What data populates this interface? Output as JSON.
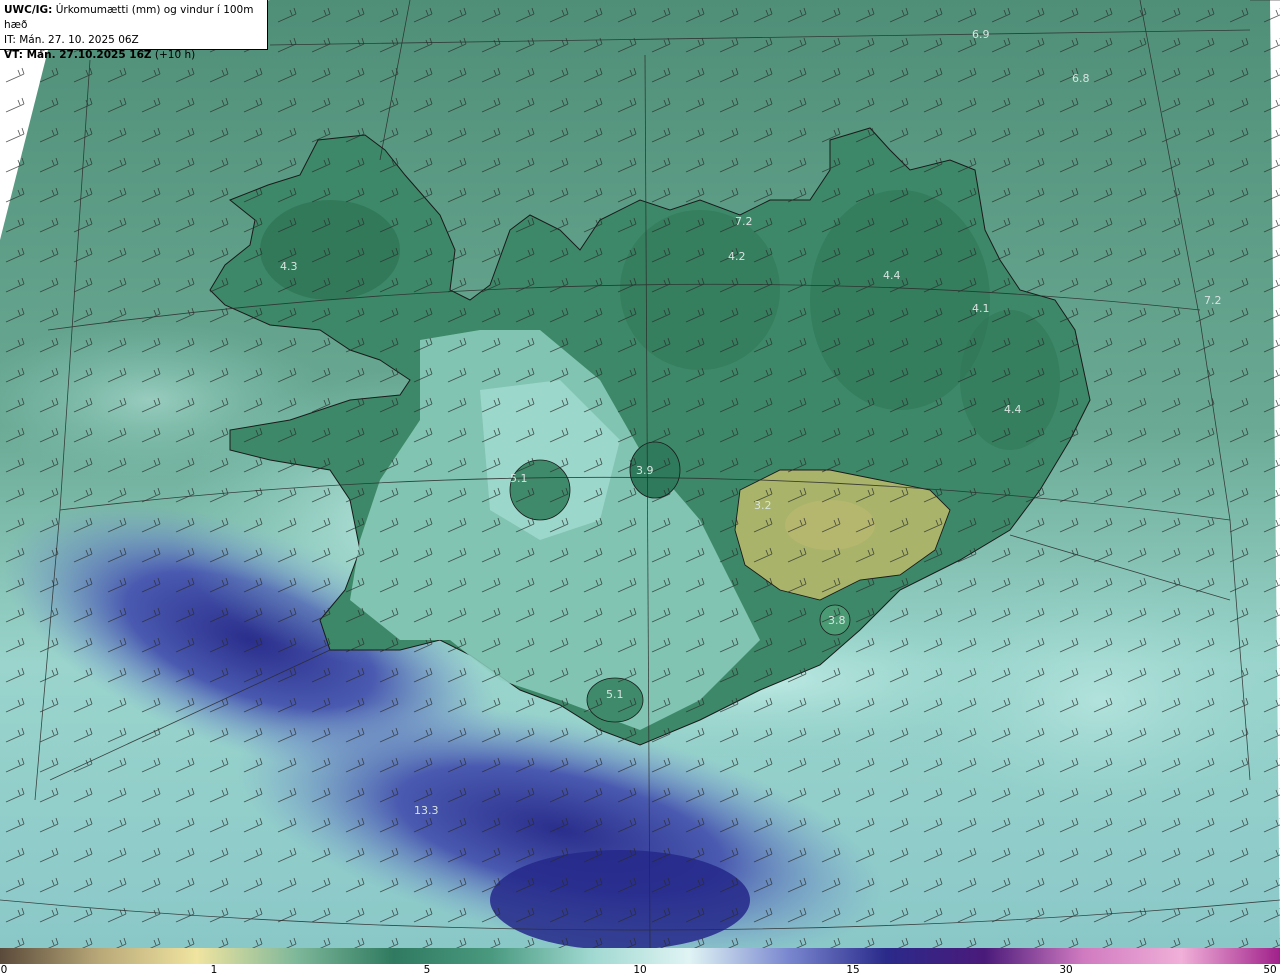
{
  "header": {
    "line1_bold": "UWC/IG:",
    "line1_text": "Úrkomumætti (mm) og vindur í 100m hæð",
    "line2": "IT: Mán. 27. 10. 2025 06Z",
    "line3_bold": "VT: Mán. 27.10.2025 16Z",
    "line3_text": "(+10 h)"
  },
  "map_values": [
    {
      "label": "6.9"
    },
    {
      "label": "6.8"
    },
    {
      "label": "4.3"
    },
    {
      "label": "7.2"
    },
    {
      "label": "4.2"
    },
    {
      "label": "4.4"
    },
    {
      "label": "4.1"
    },
    {
      "label": "7.2"
    },
    {
      "label": "4.4"
    },
    {
      "label": "3.9"
    },
    {
      "label": "5.1"
    },
    {
      "label": "3.2"
    },
    {
      "label": "3.8"
    },
    {
      "label": "5.1"
    },
    {
      "label": "13.3"
    }
  ],
  "colorbar": {
    "ticks": [
      "0",
      "1",
      "5",
      "10",
      "15",
      "30",
      "50"
    ],
    "colors": [
      "#5a4a3a",
      "#b8a878",
      "#f0e4a0",
      "#7fb89a",
      "#2f7a60",
      "#4a9a80",
      "#9fd8d0",
      "#e0f4f4",
      "#7a88d0",
      "#2a2a8a",
      "#4a1a7a",
      "#d07ac0",
      "#f0b0d8",
      "#a0208a"
    ]
  },
  "colors": {
    "land": "#3f8a6a",
    "highland": "#a7b56a",
    "coast_sea": "#a8e0da",
    "sea": "#5a9a82",
    "heavy": "#2a3a9a"
  }
}
